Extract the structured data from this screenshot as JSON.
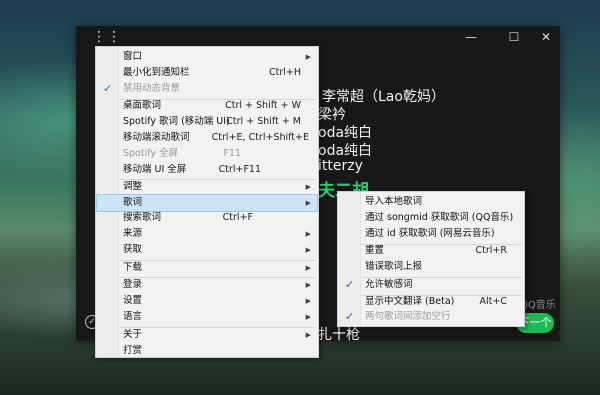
{
  "app": {
    "controls": {
      "minimize": "—",
      "maximize": "☐",
      "close": "✕"
    },
    "menu_dots": "⋮⋮",
    "lyrics": [
      {
        "text": "李常超（Lao乾妈）"
      },
      {
        "text": "梁衿"
      },
      {
        "text": "oda纯白"
      },
      {
        "text": "oda纯白"
      },
      {
        "text": "itterzy"
      },
      {
        "text": "夫二胡"
      },
      {
        "text": "扎十枪"
      }
    ],
    "source_tag": "QQ音乐",
    "next_button": "下一个"
  },
  "main_menu": {
    "items": [
      {
        "label": "窗口",
        "submenu": true
      },
      {
        "label": "最小化到通知栏",
        "shortcut": "Ctrl+H"
      },
      {
        "label": "禁用动态背景",
        "checked": true,
        "disabled": true
      },
      {
        "separator": true
      },
      {
        "label": "桌面歌词",
        "shortcut": "Ctrl + Shift + W"
      },
      {
        "label": "Spotify 歌词 (移动端 UI)",
        "shortcut": "Ctrl + Shift + M"
      },
      {
        "label": "移动端滚动歌词",
        "shortcut": "Ctrl+E, Ctrl+Shift+E"
      },
      {
        "label": "Spotify 全屏",
        "shortcut": "F11",
        "disabled": true
      },
      {
        "label": "移动端 UI 全屏",
        "shortcut": "Ctrl+F11"
      },
      {
        "separator": true
      },
      {
        "label": "调整",
        "submenu": true
      },
      {
        "label": "歌词",
        "submenu": true,
        "hover": true
      },
      {
        "label": "搜索歌词",
        "shortcut": "Ctrl+F"
      },
      {
        "label": "来源",
        "submenu": true
      },
      {
        "label": "获取",
        "submenu": true
      },
      {
        "separator": true
      },
      {
        "label": "下载",
        "submenu": true
      },
      {
        "separator": true
      },
      {
        "label": "登录",
        "submenu": true
      },
      {
        "label": "设置",
        "submenu": true
      },
      {
        "label": "语言",
        "submenu": true
      },
      {
        "separator": true
      },
      {
        "label": "关于",
        "submenu": true
      },
      {
        "label": "打赏"
      }
    ]
  },
  "lyrics_submenu": {
    "items": [
      {
        "label": "导入本地歌词"
      },
      {
        "label": "通过 songmid 获取歌词 (QQ音乐)"
      },
      {
        "label": "通过 id 获取歌词 (网易云音乐)"
      },
      {
        "separator": true
      },
      {
        "label": "重置",
        "shortcut": "Ctrl+R"
      },
      {
        "label": "错误歌词上报"
      },
      {
        "separator": true
      },
      {
        "label": "允许敏感词",
        "checked": true
      },
      {
        "separator": true
      },
      {
        "label": "显示中文翻译 (Beta)",
        "shortcut": "Alt+C"
      },
      {
        "label": "两句歌词间添加空行",
        "checked": true,
        "disabled": true
      }
    ]
  },
  "colors": {
    "accent": "#1db954",
    "highlight": "#2ecc71",
    "menu_bg": "#f2f2f2",
    "hover": "#cce4f7"
  }
}
